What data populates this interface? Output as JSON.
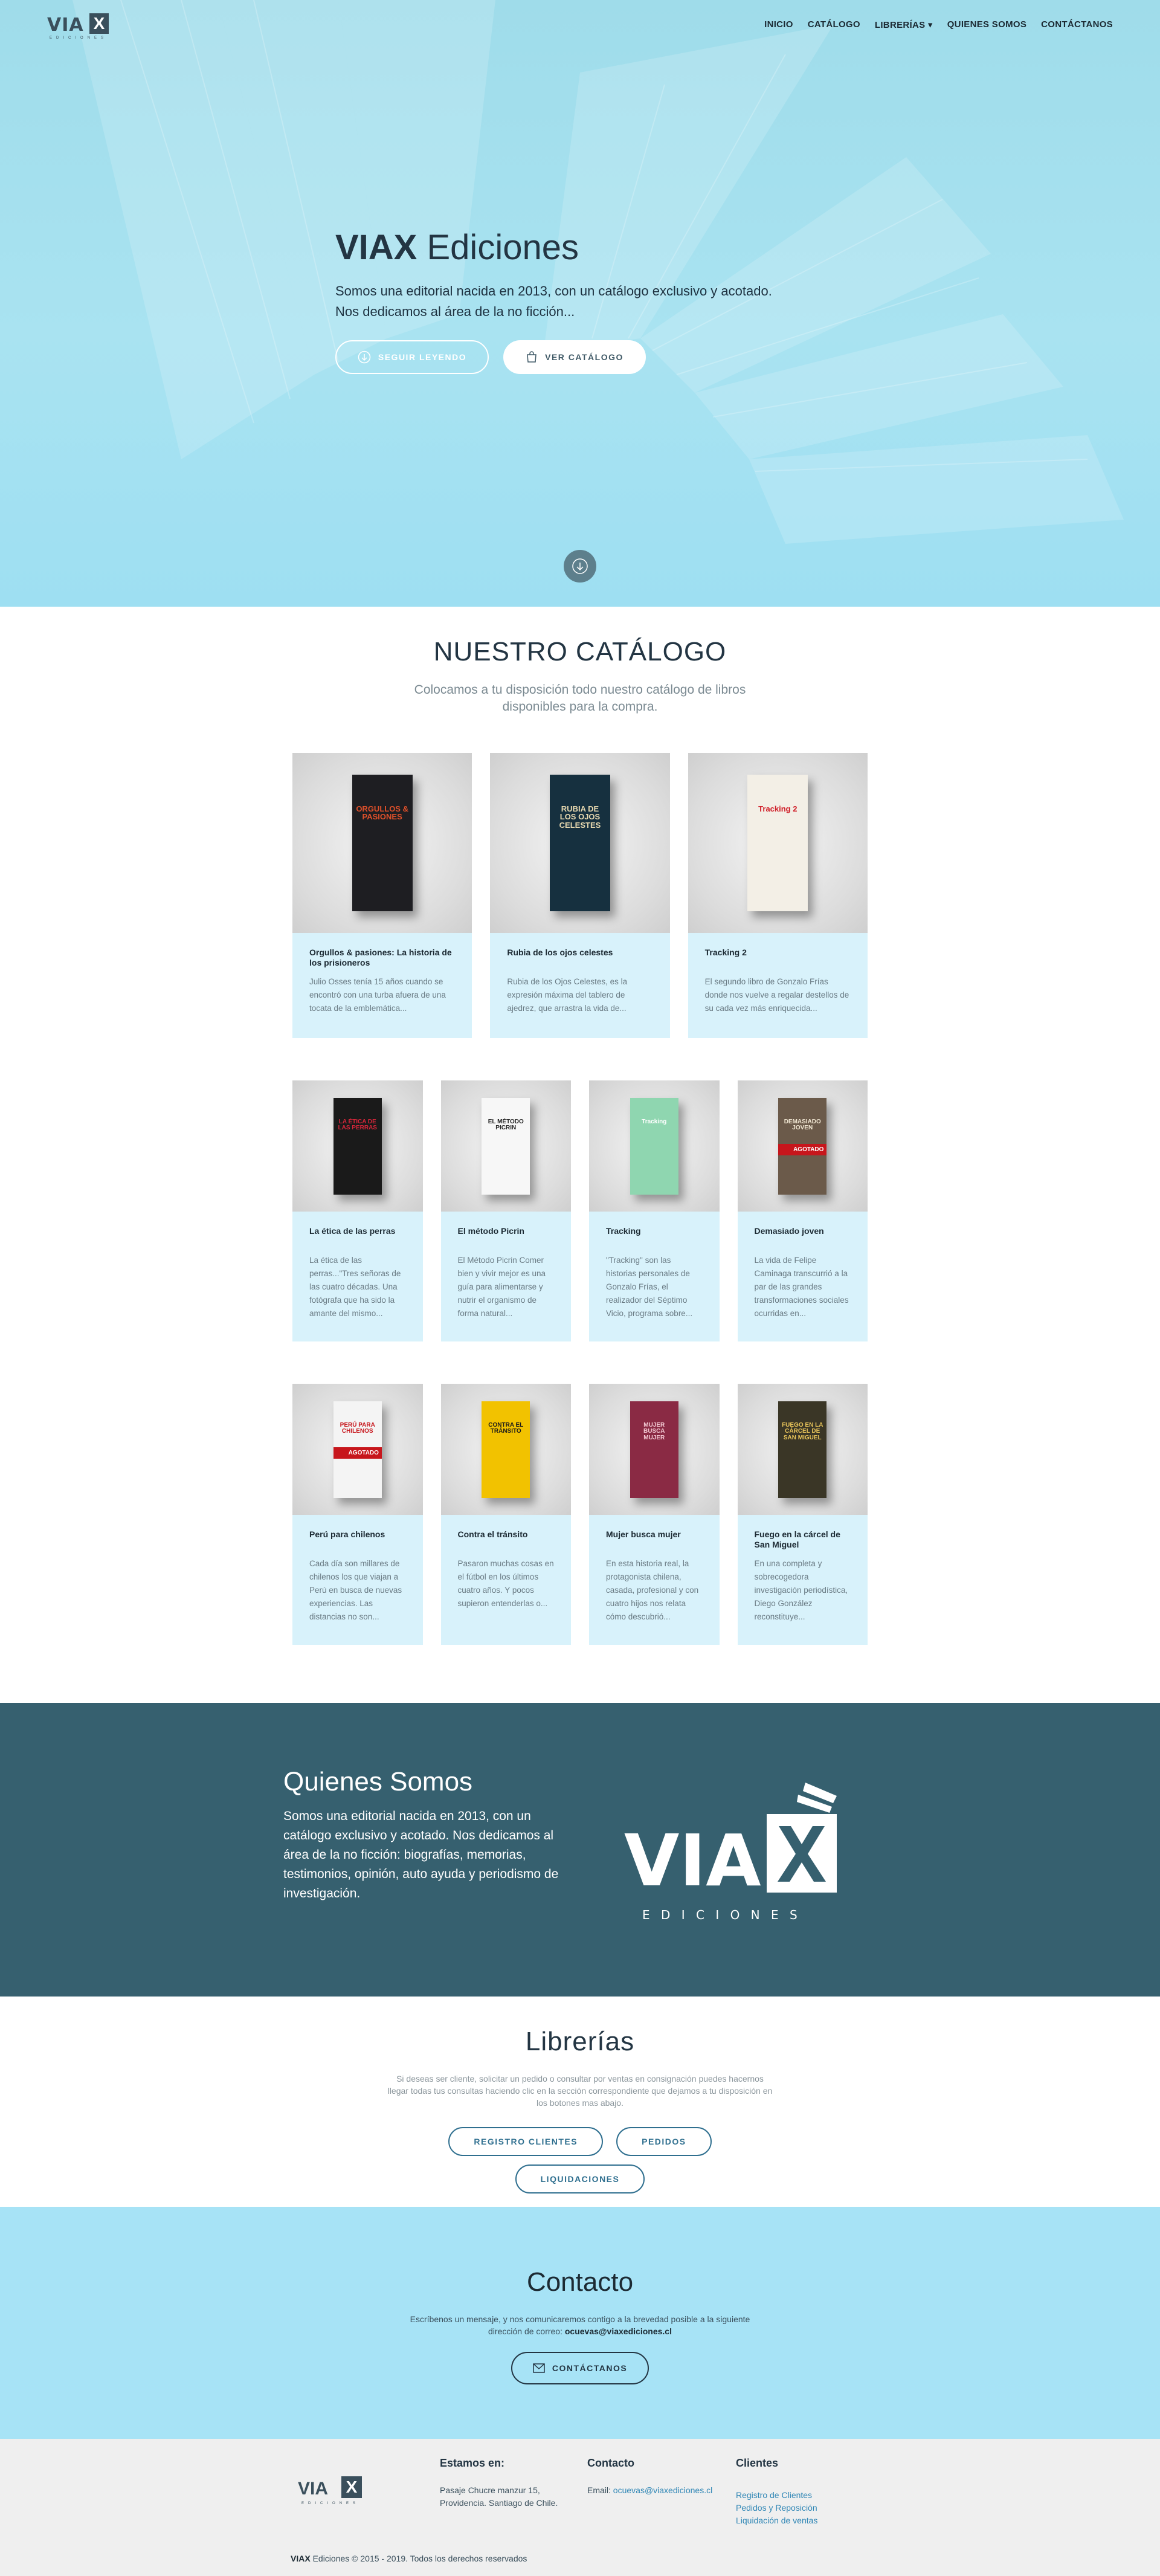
{
  "nav": {
    "logo_word": "VIA",
    "logo_x": "X",
    "logo_sub": "EDICIONES",
    "items": [
      "INICIO",
      "CATÁLOGO",
      "LIBRERÍAS ▾",
      "QUIENES SOMOS",
      "CONTÁCTANOS"
    ]
  },
  "hero": {
    "title_bold": "VIAX",
    "title_rest": " Ediciones",
    "text_line1": "Somos una editorial nacida en 2013, con un catálogo exclusivo y acotado.",
    "text_line2": "Nos dedicamos al área de la no ficción...",
    "btn_read": "SEGUIR LEYENDO",
    "btn_catalog": "VER CATÁLOGO"
  },
  "catalog": {
    "title": "NUESTRO CATÁLOGO",
    "subtitle": "Colocamos a tu disposición todo nuestro catálogo de libros disponibles para la compra.",
    "row1": [
      {
        "title": "Orgullos & pasiones: La historia de los prisioneros",
        "desc": "Julio Osses tenía 15 años cuando se encontró con una turba afuera de una tocata de la emblemática...",
        "cover_text": "ORGULLOS & PASIONES",
        "cover_bg": "#1e1e22",
        "cover_fg": "#e0502a"
      },
      {
        "title": "Rubia de los ojos celestes",
        "desc": "Rubia de los Ojos Celestes, es la expresión máxima del tablero de ajedrez, que arrastra la vida de...",
        "cover_text": "RUBIA DE LOS OJOS CELESTES",
        "cover_bg": "#16303f",
        "cover_fg": "#e8d9b0"
      },
      {
        "title": "Tracking 2",
        "desc": "El segundo libro de Gonzalo Frías donde nos vuelve a regalar destellos de su cada vez más enriquecida...",
        "cover_text": "Tracking 2",
        "cover_bg": "#f3efe6",
        "cover_fg": "#d0202a"
      }
    ],
    "row2": [
      {
        "title": "La ética de las perras",
        "desc": "La ética de las perras...\"Tres señoras de las cuatro décadas. Una fotógrafa que ha sido la amante del mismo...",
        "cover_text": "LA ÉTICA DE LAS PERRAS",
        "cover_bg": "#1a1a1a",
        "cover_fg": "#d8263a",
        "tag": ""
      },
      {
        "title": "El método Picrin",
        "desc": "El Método Picrin Comer bien y vivir mejor es una guía para alimentarse y nutrir el organismo de forma natural...",
        "cover_text": "EL MÉTODO PICRIN",
        "cover_bg": "#f7f7f7",
        "cover_fg": "#222222",
        "tag": ""
      },
      {
        "title": "Tracking",
        "desc": "\"Tracking\" son las historias personales de Gonzalo Frías, el realizador del Séptimo Vicio, programa sobre...",
        "cover_text": "Tracking",
        "cover_bg": "#8fd6b0",
        "cover_fg": "#ffffff",
        "tag": ""
      },
      {
        "title": "Demasiado joven",
        "desc": "La vida de Felipe Caminaga transcurrió a la par de las grandes transformaciones sociales ocurridas en...",
        "cover_text": "DEMASIADO JOVEN",
        "cover_bg": "#6b5a4a",
        "cover_fg": "#f0e6d2",
        "tag": "AGOTADO"
      }
    ],
    "row3": [
      {
        "title": "Perú para chilenos",
        "desc": "Cada día son millares de chilenos los que viajan a Perú en busca de nuevas experiencias. Las distancias no son...",
        "cover_text": "PERÚ PARA CHILENOS",
        "cover_bg": "#f4f4f4",
        "cover_fg": "#c7161c",
        "tag": "AGOTADO"
      },
      {
        "title": "Contra el tránsito",
        "desc": "Pasaron muchas cosas en el fútbol en los últimos cuatro años. Y pocos supieron entenderlas o...",
        "cover_text": "CONTRA EL TRÁNSITO",
        "cover_bg": "#f2c200",
        "cover_fg": "#1a1a1a",
        "tag": ""
      },
      {
        "title": "Mujer busca mujer",
        "desc": "En esta historia real, la protagonista chilena, casada, profesional y con cuatro hijos nos relata cómo descubrió...",
        "cover_text": "MUJER BUSCA MUJER",
        "cover_bg": "#8a2a44",
        "cover_fg": "#f3c9d3",
        "tag": ""
      },
      {
        "title": "Fuego en la cárcel de San Miguel",
        "desc": "En una completa y sobrecogedora investigación periodística, Diego González reconstituye...",
        "cover_text": "FUEGO EN LA CÁRCEL DE SAN MIGUEL",
        "cover_bg": "#3a3626",
        "cover_fg": "#e9c55a",
        "tag": ""
      }
    ]
  },
  "about": {
    "title": "Quienes Somos",
    "text": "Somos una editorial nacida en 2013, con un catálogo exclusivo y acotado. Nos dedicamos al área de la no ficción: biografías, memorias, testimonios, opinión, auto ayuda y periodismo de investigación.",
    "logo_word": "VIA",
    "logo_x": "X",
    "logo_sub": "E D I C I O N E S"
  },
  "librerias": {
    "title": "Librerías",
    "text": "Si deseas ser cliente, solicitar un pedido o consultar por ventas en consignación puedes hacernos llegar todas tus consultas haciendo clic en la sección correspondiente que dejamos a tu disposición en los botones mas abajo.",
    "btn_registro": "REGISTRO CLIENTES",
    "btn_pedidos": "PEDIDOS",
    "btn_liquidaciones": "LIQUIDACIONES"
  },
  "contact": {
    "title": "Contacto",
    "text": "Escríbenos un mensaje, y nos comunicaremos contigo a la brevedad posible a la siguiente dirección de correo:",
    "email": "ocuevas@viaxediciones.cl",
    "btn": "CONTÁCTANOS"
  },
  "footer": {
    "col1_title": "Estamos en:",
    "col1_text": "Pasaje Chucre manzur 15, Providencia. Santiago de Chile.",
    "col2_title": "Contacto",
    "col2_label": "Email:",
    "col2_email": "ocuevas@viaxediciones.cl",
    "col3_title": "Clientes",
    "col3_links": [
      "Registro de Clientes",
      "Pedidos y Reposición",
      "Liquidación de ventas"
    ],
    "copy_bold": "VIAX",
    "copy_rest": " Ediciones © 2015 - 2019. Todos los derechos reservados"
  },
  "colors": {
    "hero_bg": "#a9e3f1",
    "card_bg": "#d8f2fb",
    "about_bg": "#36606f",
    "contact_bg": "#a7e3f6",
    "footer_bg": "#efefef",
    "accent": "#2f6f8f"
  }
}
